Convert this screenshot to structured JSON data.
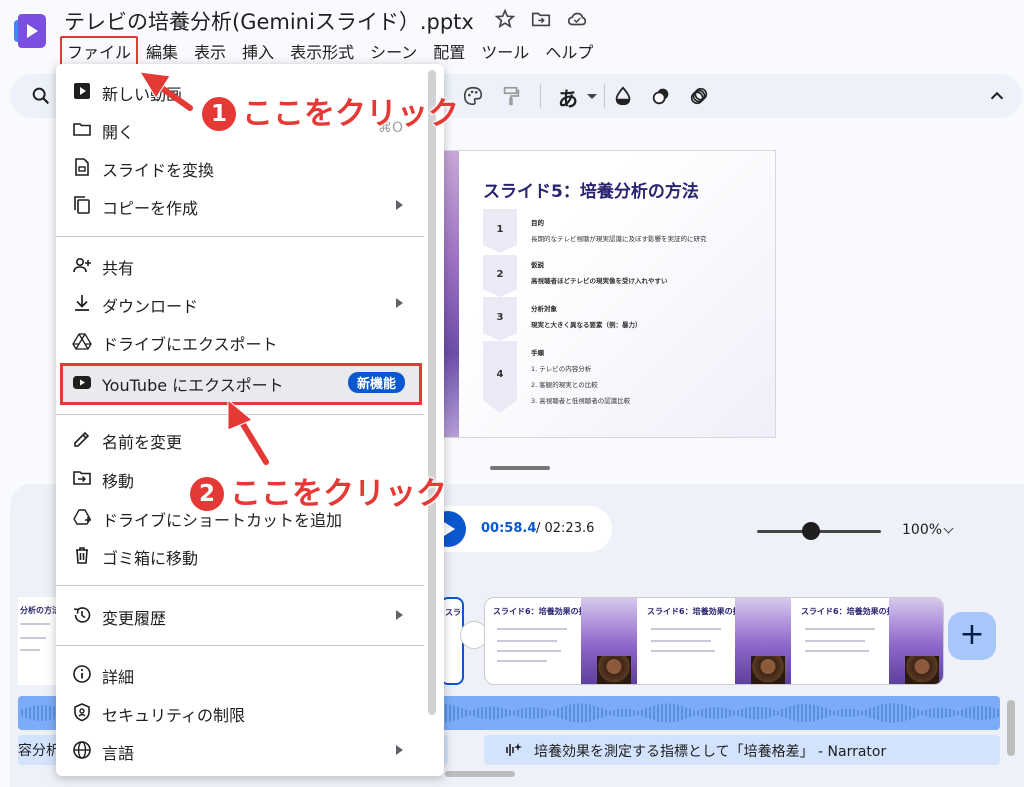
{
  "doc_title": "テレビの培養分析(Geminiスライド）.pptx",
  "menubar": [
    "ファイル",
    "編集",
    "表示",
    "挿入",
    "表示形式",
    "シーン",
    "配置",
    "ツール",
    "ヘルプ"
  ],
  "file_menu": {
    "items": [
      {
        "label": "新しい動画",
        "icon": "play-box-icon"
      },
      {
        "label": "開く",
        "icon": "folder-icon",
        "shortcut": "⌘O"
      },
      {
        "label": "スライドを変換",
        "icon": "slides-file-icon"
      },
      {
        "label": "コピーを作成",
        "icon": "copy-icon"
      },
      {
        "label": "共有",
        "icon": "person-add-icon"
      },
      {
        "label": "ダウンロード",
        "icon": "download-icon"
      },
      {
        "label": "ドライブにエクスポート",
        "icon": "drive-icon"
      },
      {
        "label": "YouTube にエクスポート",
        "icon": "youtube-icon",
        "badge": "新機能"
      },
      {
        "label": "名前を変更",
        "icon": "pencil-icon"
      },
      {
        "label": "移動",
        "icon": "move-folder-icon"
      },
      {
        "label": "ドライブにショートカットを追加",
        "icon": "drive-shortcut-icon"
      },
      {
        "label": "ゴミ箱に移動",
        "icon": "trash-icon"
      },
      {
        "label": "変更履歴",
        "icon": "history-icon"
      },
      {
        "label": "詳細",
        "icon": "info-icon"
      },
      {
        "label": "セキュリティの制限",
        "icon": "shield-lock-icon"
      },
      {
        "label": "言語",
        "icon": "globe-icon"
      }
    ]
  },
  "slide": {
    "title": "スライド5：培養分析の方法",
    "steps": [
      {
        "num": "1",
        "head": "目的",
        "body": [
          "長期的なテレビ視聴が現実認識に及ぼす影響を実証的に研究"
        ]
      },
      {
        "num": "2",
        "head": "仮説",
        "body": [
          "高視聴者ほどテレビの現実像を受け入れやすい"
        ]
      },
      {
        "num": "3",
        "head": "分析対象",
        "body": [
          "現実と大きく異なる要素（例：暴力）"
        ]
      },
      {
        "num": "4",
        "head": "手順",
        "body": [
          "1. テレビの内容分析",
          "2. 客観的現実との比較",
          "3. 高視聴者と低視聴者の認識比較"
        ]
      }
    ]
  },
  "player": {
    "current_time": "00:58.4",
    "total_time": "/ 02:23.6",
    "zoom": "100%"
  },
  "timeline": {
    "clip_left_title": "分析の方法",
    "clip_sel_title": "スライ",
    "clip_title": "スライド6：培養効果の指",
    "audio_cut_text": "容分析",
    "narration": "培養効果を測定する指標として「培養格差」 - Narrator"
  },
  "annotations": {
    "step1": "ここをクリック",
    "step1_num": "1",
    "step2": "ここをクリック",
    "step2_num": "2"
  },
  "colors": {
    "accent": "#0b57d0",
    "annotation": "#e53935",
    "slide_title": "#2a2470"
  }
}
